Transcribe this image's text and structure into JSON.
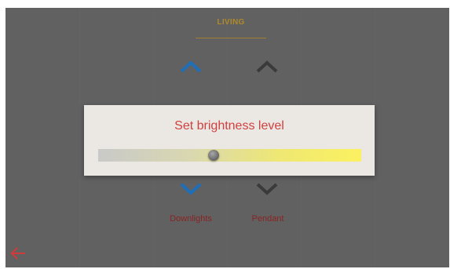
{
  "room": {
    "name": "LIVING"
  },
  "fixtures": [
    {
      "label": "Downlights",
      "accent": "#1e6fb8"
    },
    {
      "label": "Pendant",
      "accent": "#3a3a3a"
    }
  ],
  "dialog": {
    "title": "Set brightness level",
    "brightness_fraction": 0.44
  },
  "colors": {
    "background": "#616161",
    "dialog_bg": "#ebe8e3",
    "title": "#d04040",
    "label": "#8a2323",
    "back_arrow": "#d03a3a",
    "room_tab": "#b08a2a"
  },
  "icons": {
    "up": "chevron-up-icon",
    "down": "chevron-down-icon",
    "back": "arrow-left-icon"
  }
}
